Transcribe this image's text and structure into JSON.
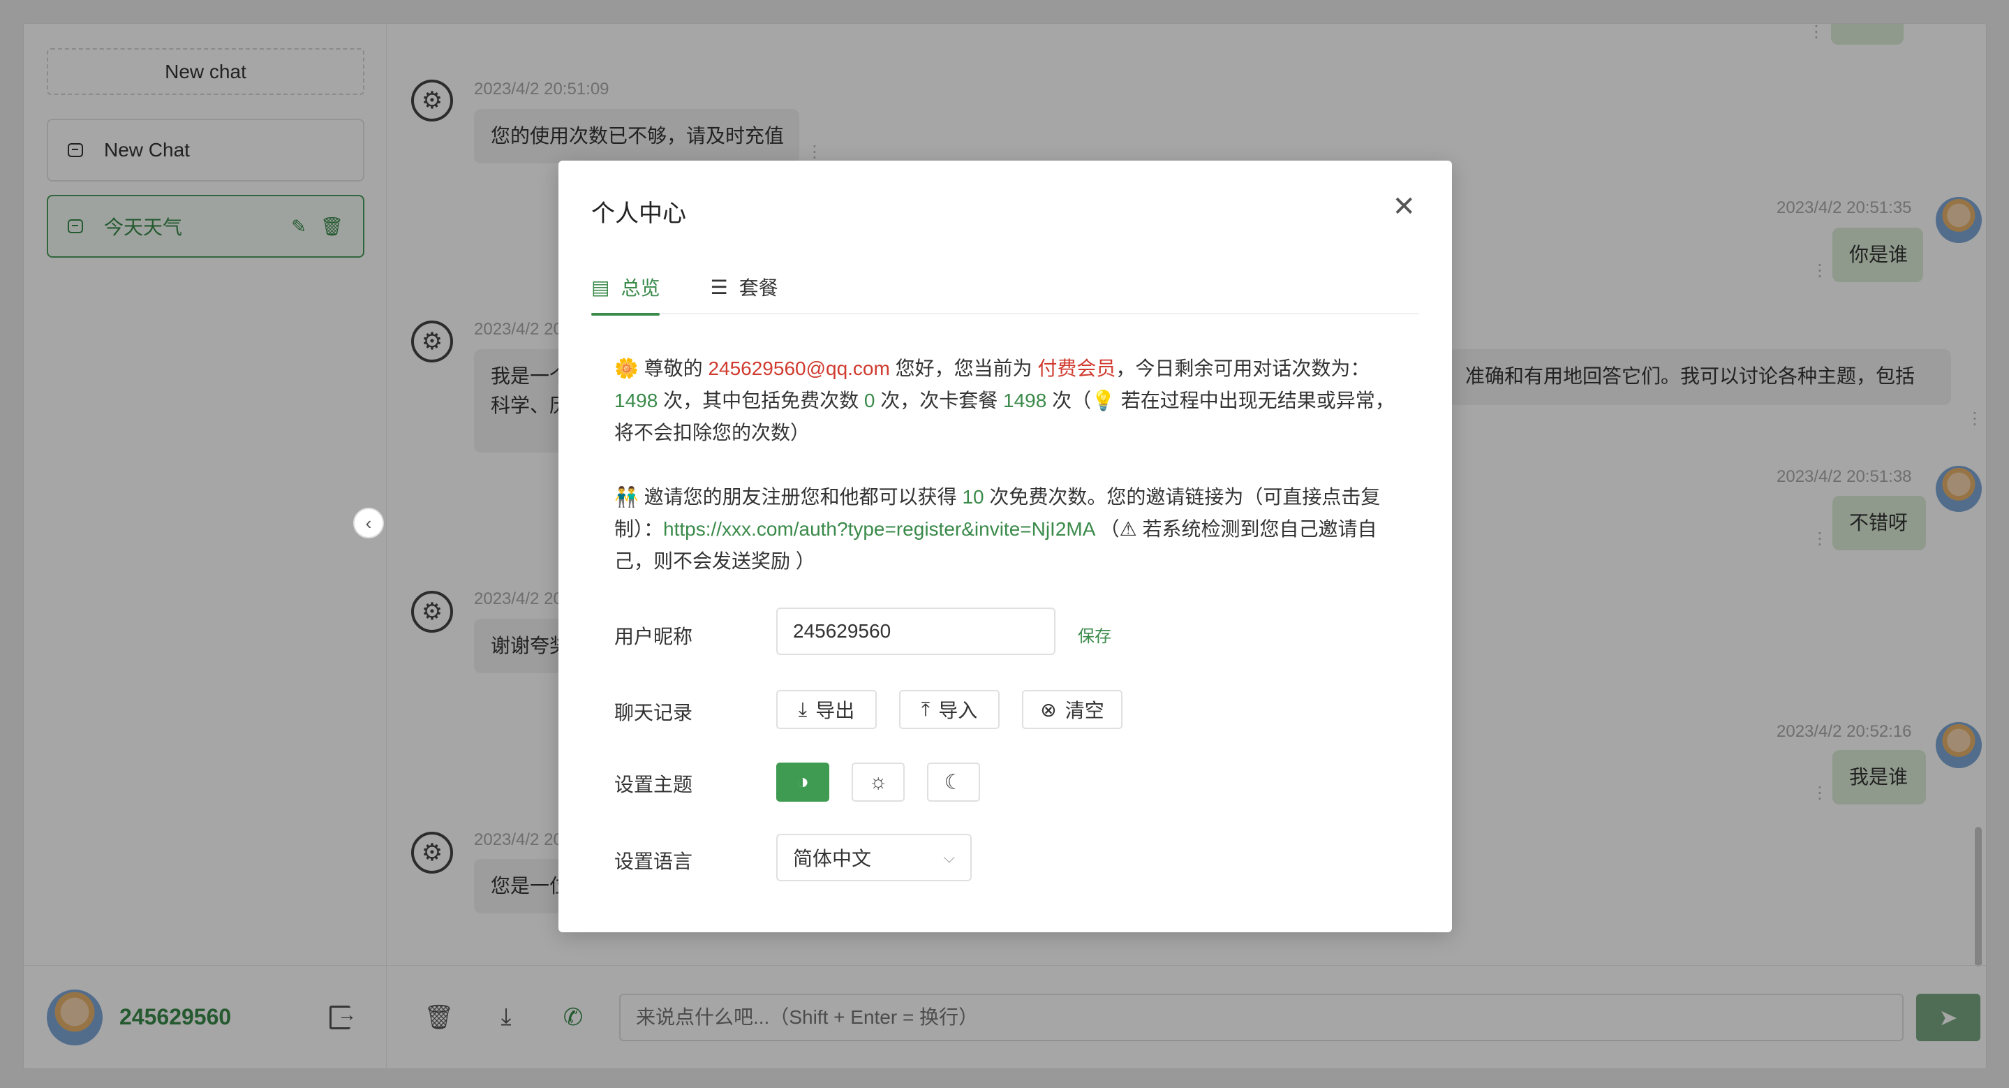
{
  "sidebar": {
    "new_chat_label": "New chat",
    "conversations": [
      {
        "title": "New Chat"
      },
      {
        "title": "今天天气",
        "edit_icon": "✎",
        "delete_icon": "🗑"
      }
    ],
    "user_name": "245629560"
  },
  "chat": {
    "messages": [
      {
        "role": "bot",
        "time": "2023/4/2 20:51:09",
        "text": "您的使用次数已不够，请及时充值"
      },
      {
        "role": "user",
        "time": "2023/4/2 20:51:35",
        "text": "你是谁"
      },
      {
        "role": "bot",
        "time": "2023/4/2 20",
        "text": "我是一个",
        "text2": "科学、历"
      },
      {
        "role": "bot_right_fragment",
        "text": "准确和有用地回答它们。我可以讨论各种主题，包括"
      },
      {
        "role": "user",
        "time": "2023/4/2 20:51:38",
        "text": "不错呀"
      },
      {
        "role": "bot",
        "time": "2023/4/2 20",
        "text": "谢谢夸奖"
      },
      {
        "role": "user",
        "time": "2023/4/2 20:52:16",
        "text": "我是谁"
      },
      {
        "role": "bot",
        "time": "2023/4/2 20",
        "text": "您是一位"
      }
    ],
    "input_placeholder": "来说点什么吧...（Shift + Enter = 换行）",
    "send_icon": "➤"
  },
  "modal": {
    "title": "个人中心",
    "close_icon": "✕",
    "tabs": [
      {
        "label": "总览",
        "icon": "▤"
      },
      {
        "label": "套餐",
        "icon": "☰"
      }
    ],
    "overview": {
      "p1_emoji": "🌼",
      "p1_a": " 尊敬的 ",
      "email": "245629560@qq.com",
      "p1_b": " 您好，您当前为 ",
      "member_type": "付费会员",
      "p1_c": "，今日剩余可用对话次数为：",
      "remaining": "1498",
      "p1_d": " 次，其中包括免费次数 ",
      "free_count": "0",
      "p1_e": " 次，次卡套餐 ",
      "card_count": "1498",
      "p1_f": " 次（💡 若在过程中出现无结果或异常，将不会扣除您的次数）",
      "p2_emoji": "👬",
      "p2_a": " 邀请您的朋友注册您和他都可以获得 ",
      "invite_bonus": "10",
      "p2_b": " 次免费次数。您的邀请链接为（可直接点击复制）：",
      "invite_link": "https://xxx.com/auth?type=register&invite=NjI2MA",
      "p2_c": " （⚠ 若系统检测到您自己邀请自己，则不会发送奖励 ）"
    },
    "nickname_label": "用户昵称",
    "nickname_value": "245629560",
    "save_label": "保存",
    "history_label": "聊天记录",
    "export_label": "导出",
    "import_label": "导入",
    "clear_label": "清空",
    "theme_label": "设置主题",
    "language_label": "设置语言",
    "language_value": "简体中文"
  }
}
